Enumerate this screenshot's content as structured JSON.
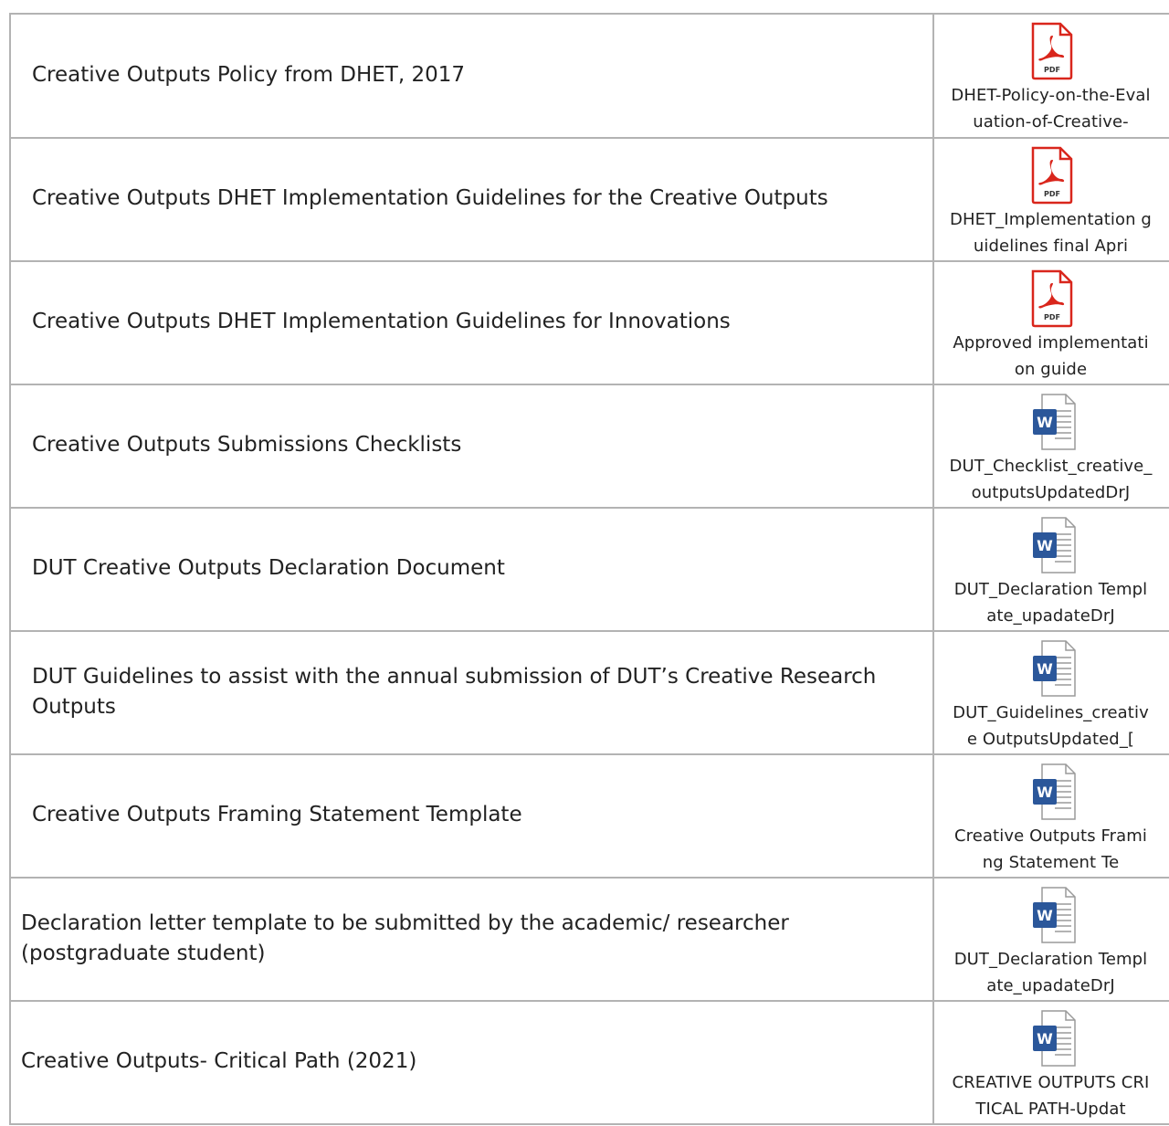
{
  "documents": [
    {
      "description": "Creative Outputs Policy from DHET, 2017",
      "file_type": "pdf",
      "icon": "pdf-icon",
      "file_name": "DHET-Policy-on-the-Evaluation-of-Creative-"
    },
    {
      "description": "Creative Outputs DHET Implementation Guidelines for the Creative Outputs",
      "file_type": "pdf",
      "icon": "pdf-icon",
      "file_name": "DHET_Implementation guidelines final Apri"
    },
    {
      "description": "Creative Outputs DHET Implementation Guidelines for Innovations",
      "file_type": "pdf",
      "icon": "pdf-icon",
      "file_name": "Approved implementation guide"
    },
    {
      "description": "Creative Outputs Submissions Checklists",
      "file_type": "word",
      "icon": "word-icon",
      "file_name": "DUT_Checklist_creative_outputsUpdatedDrJ"
    },
    {
      "description": "DUT Creative Outputs Declaration Document",
      "file_type": "word",
      "icon": "word-icon",
      "file_name": "DUT_Declaration Template_upadateDrJ"
    },
    {
      "description": "DUT Guidelines to assist with the annual submission of DUT’s Creative Research Outputs",
      "file_type": "word",
      "icon": "word-icon",
      "file_name": "DUT_Guidelines_creative OutputsUpdated_["
    },
    {
      "description": "Creative Outputs Framing Statement Template",
      "file_type": "word",
      "icon": "word-icon",
      "file_name": "Creative Outputs Framing Statement Te"
    },
    {
      "description": "Declaration letter template to be submitted by the academic/ researcher (postgraduate student)",
      "file_type": "word",
      "icon": "word-icon",
      "file_name": "DUT_Declaration Template_upadateDrJ"
    },
    {
      "description": "Creative Outputs- Critical Path (2021)",
      "file_type": "word",
      "icon": "word-icon",
      "file_name": "CREATIVE OUTPUTS CRITICAL PATH-Updat"
    }
  ],
  "colors": {
    "border": "#b3b3b3",
    "pdf_red": "#d9261c",
    "word_blue": "#2b579a",
    "text": "#222222"
  }
}
